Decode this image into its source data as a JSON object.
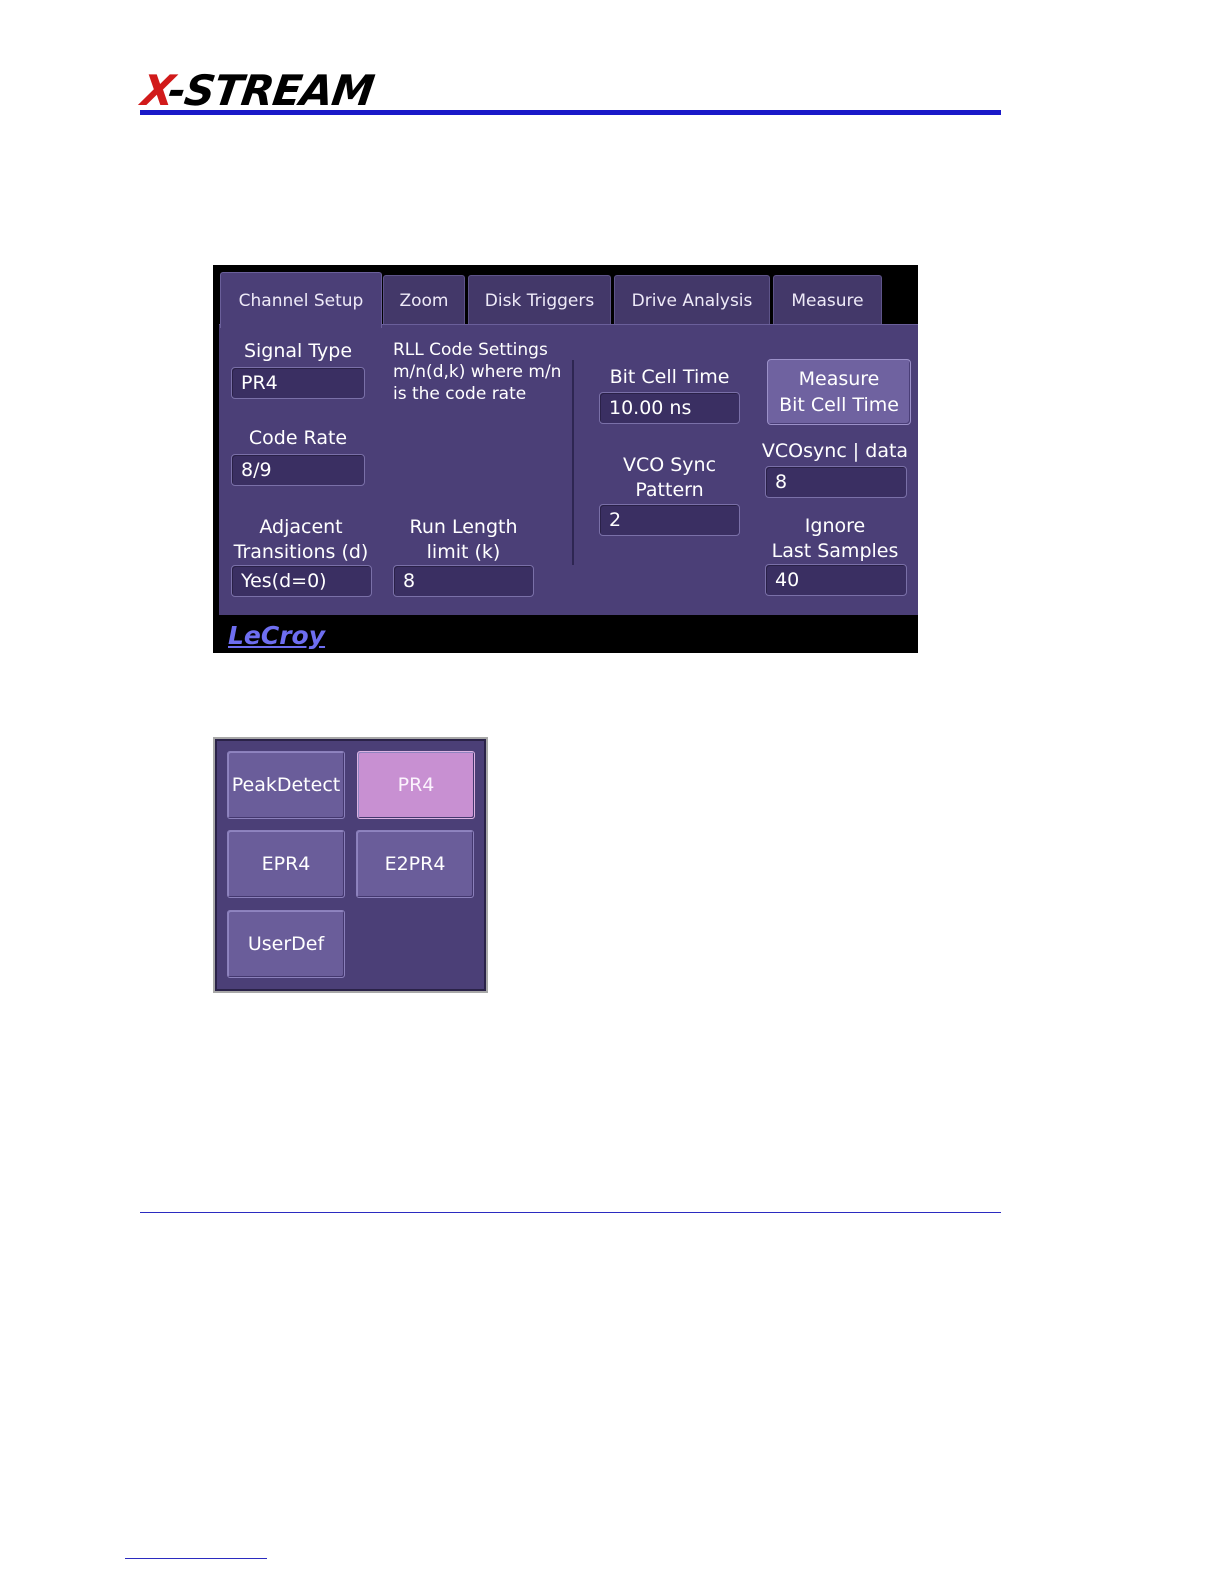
{
  "page": {
    "brand": {
      "x": "X",
      "rest": "-STREAM"
    }
  },
  "dialog": {
    "tabs": [
      "Channel Setup",
      "Zoom",
      "Disk Triggers",
      "Drive Analysis",
      "Measure"
    ],
    "active_tab": "Channel Setup",
    "signal_type": {
      "label": "Signal Type",
      "value": "PR4"
    },
    "code_rate": {
      "label": "Code Rate",
      "value": "8/9"
    },
    "adjacent": {
      "label_line1": "Adjacent",
      "label_line2": "Transitions (d)",
      "value": "Yes(d=0)"
    },
    "rll_note": [
      "RLL Code Settings",
      "m/n(d,k) where m/n",
      "is the code rate"
    ],
    "run_length": {
      "label_line1": "Run Length",
      "label_line2": "limit (k)",
      "value": "8"
    },
    "bit_cell_time": {
      "label": "Bit Cell Time",
      "value": "10.00 ns"
    },
    "measure_button": {
      "line1": "Measure",
      "line2": "Bit Cell Time"
    },
    "vco_sync": {
      "label_line1": "VCO Sync",
      "label_line2": "Pattern",
      "value": "2"
    },
    "vcosync_data": {
      "label": "VCOsync | data",
      "value": "8"
    },
    "ignore": {
      "label_line1": "Ignore",
      "label_line2": "Last Samples",
      "value": "40"
    },
    "footer_logo": "LeCroy"
  },
  "popup": {
    "options": [
      "PeakDetect",
      "PR4",
      "EPR4",
      "E2PR4",
      "UserDef"
    ],
    "selected": "PR4"
  },
  "colors": {
    "panel": "#4b3f77",
    "selected_option": "#c890d2",
    "brand_rule": "#1a19c8"
  }
}
